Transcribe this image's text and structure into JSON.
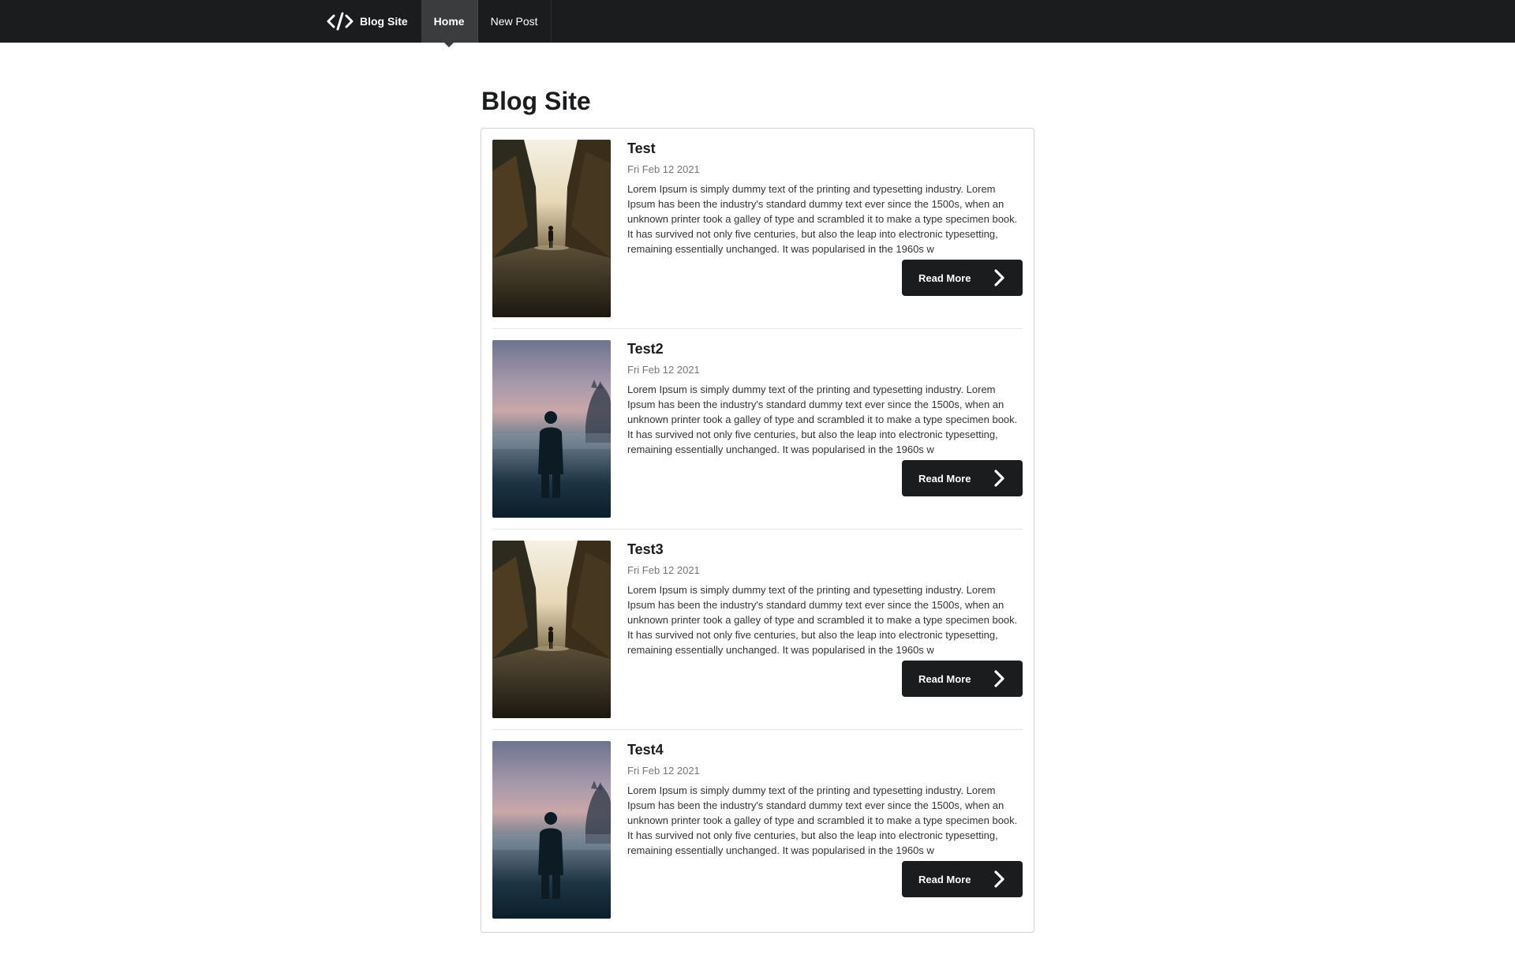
{
  "nav": {
    "brand": "Blog Site",
    "brand_icon": "code-icon",
    "items": [
      {
        "label": "Home",
        "active": true
      },
      {
        "label": "New Post",
        "active": false
      }
    ]
  },
  "page": {
    "title": "Blog Site"
  },
  "posts": [
    {
      "title": "Test",
      "date": "Fri Feb 12 2021",
      "excerpt": "Lorem Ipsum is simply dummy text of the printing and typesetting industry. Lorem Ipsum has been the industry's standard dummy text ever since the 1500s, when an unknown printer took a galley of type and scrambled it to make a type specimen book. It has survived not only five centuries, but also the leap into electronic typesetting, remaining essentially unchanged. It was popularised in the 1960s w",
      "image": "forest-path-photo",
      "button": "Read More"
    },
    {
      "title": "Test2",
      "date": "Fri Feb 12 2021",
      "excerpt": "Lorem Ipsum is simply dummy text of the printing and typesetting industry. Lorem Ipsum has been the industry's standard dummy text ever since the 1500s, when an unknown printer took a galley of type and scrambled it to make a type specimen book. It has survived not only five centuries, but also the leap into electronic typesetting, remaining essentially unchanged. It was popularised in the 1960s w",
      "image": "misty-silhouette-photo",
      "button": "Read More"
    },
    {
      "title": "Test3",
      "date": "Fri Feb 12 2021",
      "excerpt": "Lorem Ipsum is simply dummy text of the printing and typesetting industry. Lorem Ipsum has been the industry's standard dummy text ever since the 1500s, when an unknown printer took a galley of type and scrambled it to make a type specimen book. It has survived not only five centuries, but also the leap into electronic typesetting, remaining essentially unchanged. It was popularised in the 1960s w",
      "image": "forest-path-photo",
      "button": "Read More"
    },
    {
      "title": "Test4",
      "date": "Fri Feb 12 2021",
      "excerpt": "Lorem Ipsum is simply dummy text of the printing and typesetting industry. Lorem Ipsum has been the industry's standard dummy text ever since the 1500s, when an unknown printer took a galley of type and scrambled it to make a type specimen book. It has survived not only five centuries, but also the leap into electronic typesetting, remaining essentially unchanged. It was popularised in the 1960s w",
      "image": "misty-silhouette-photo",
      "button": "Read More"
    }
  ],
  "colors": {
    "navbar": "#1b1c1d",
    "nav_active": "#3b3c3d",
    "button": "#1b1c1d",
    "date_text": "#767676",
    "border": "#d4d4d5"
  }
}
